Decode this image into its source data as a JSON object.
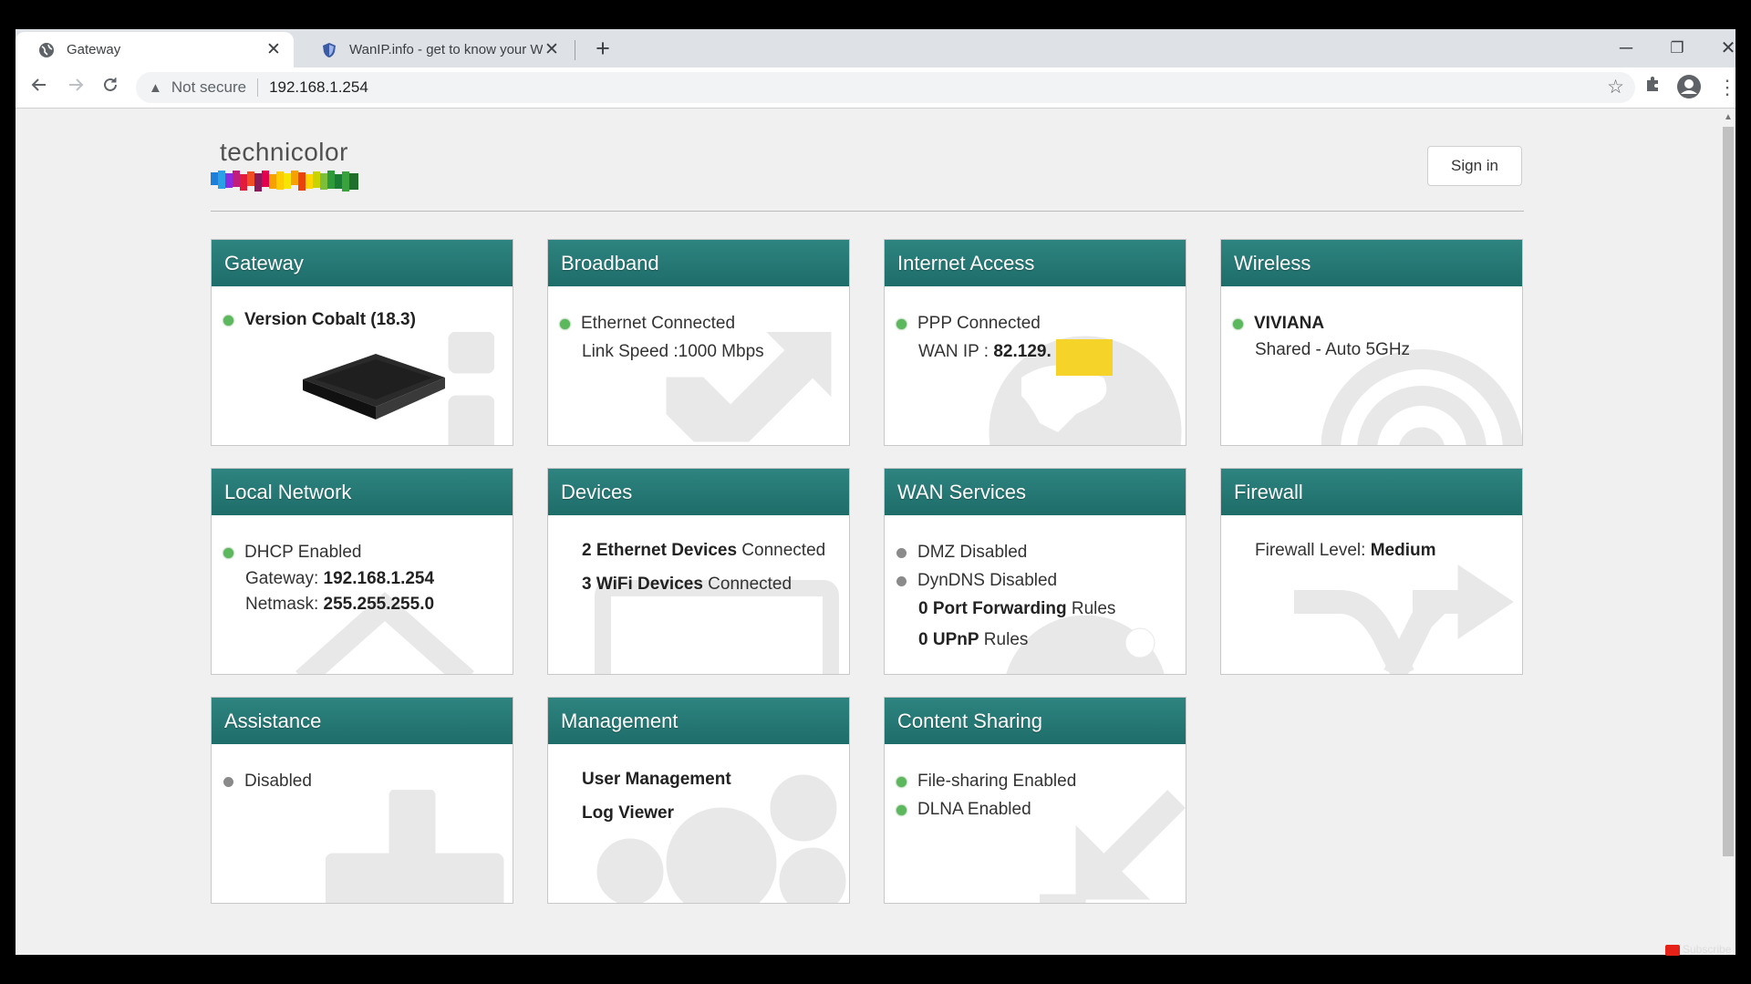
{
  "browser": {
    "tabs": [
      {
        "title": "Gateway",
        "active": true
      },
      {
        "title": "WanIP.info - get to know your W",
        "active": false
      }
    ],
    "new_tab": "+",
    "window": {
      "minimize": "─",
      "restore": "❐",
      "close": "✕"
    },
    "security_label": "Not secure",
    "url": "192.168.1.254"
  },
  "header": {
    "logo_text": "technicolor",
    "signin_label": "Sign in"
  },
  "cards": {
    "gateway": {
      "title": "Gateway",
      "version": "Version Cobalt (18.3)"
    },
    "broadband": {
      "title": "Broadband",
      "status": "Ethernet Connected",
      "link_speed": "Link Speed :1000 Mbps"
    },
    "internet": {
      "title": "Internet Access",
      "status": "PPP Connected",
      "wan_ip_label": "WAN IP : ",
      "wan_ip_value": "82.129."
    },
    "wireless": {
      "title": "Wireless",
      "ssid": "VIVIANA",
      "band": "Shared - Auto 5GHz"
    },
    "local_network": {
      "title": "Local Network",
      "dhcp": "DHCP Enabled",
      "gateway_label": "Gateway: ",
      "gateway_value": "192.168.1.254",
      "netmask_label": "Netmask: ",
      "netmask_value": "255.255.255.0"
    },
    "devices": {
      "title": "Devices",
      "eth_count": "2 Ethernet Devices",
      "eth_suffix": " Connected",
      "wifi_count": "3 WiFi Devices",
      "wifi_suffix": " Connected"
    },
    "wan_services": {
      "title": "WAN Services",
      "dmz": "DMZ Disabled",
      "dyndns": "DynDNS Disabled",
      "pf_count": "0 Port Forwarding",
      "pf_suffix": " Rules",
      "upnp_count": "0 UPnP",
      "upnp_suffix": " Rules"
    },
    "firewall": {
      "title": "Firewall",
      "level_label": "Firewall Level: ",
      "level_value": "Medium"
    },
    "assistance": {
      "title": "Assistance",
      "status": "Disabled"
    },
    "management": {
      "title": "Management",
      "user_mgmt": "User Management",
      "log_viewer": "Log Viewer"
    },
    "content_sharing": {
      "title": "Content Sharing",
      "file_sharing": "File-sharing Enabled",
      "dlna": "DLNA Enabled"
    }
  },
  "overlay": {
    "subscribe": "Subscribe"
  },
  "colors": {
    "card_header": "#1e6d6a",
    "status_green": "#5cb85c",
    "status_gray": "#8a8a8a",
    "redaction": "#f5d328"
  }
}
